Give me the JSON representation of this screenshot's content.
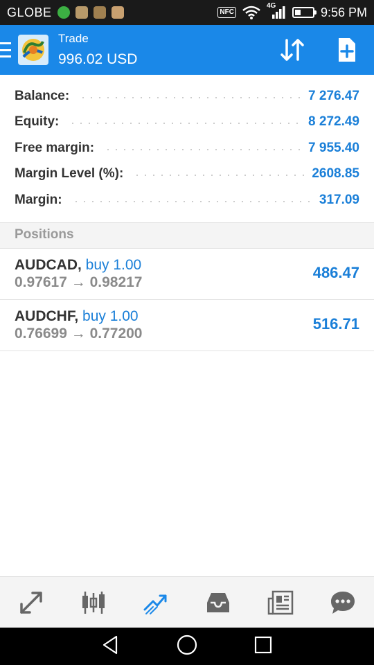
{
  "status_bar": {
    "carrier": "GLOBE",
    "network_label": "4G",
    "time": "9:56 PM",
    "icons": [
      "whatsapp-icon",
      "app-icon-a",
      "app-icon-b",
      "app-icon-c",
      "nfc-icon",
      "wifi-icon",
      "signal-icon",
      "battery-icon"
    ]
  },
  "app_bar": {
    "title": "Trade",
    "subtitle": "996.02 USD",
    "icons": [
      "menu-icon",
      "metatrader-logo",
      "sort-icon",
      "new-order-icon"
    ],
    "accent_color": "#1a88e8"
  },
  "summary": {
    "rows": [
      {
        "label": "Balance:",
        "value": "7 276.47"
      },
      {
        "label": "Equity:",
        "value": "8 272.49"
      },
      {
        "label": "Free margin:",
        "value": "7 955.40"
      },
      {
        "label": "Margin Level (%):",
        "value": "2608.85"
      },
      {
        "label": "Margin:",
        "value": "317.09"
      }
    ]
  },
  "positions": {
    "header": "Positions",
    "items": [
      {
        "symbol": "AUDCAD,",
        "side": "buy 1.00",
        "prices": "0.97617 → 0.98217",
        "profit": "486.47"
      },
      {
        "symbol": "AUDCHF,",
        "side": "buy 1.00",
        "prices": "0.76699 → 0.77200",
        "profit": "516.71"
      }
    ]
  },
  "bottom_tabs": {
    "items": [
      "quotes-icon",
      "chart-icon",
      "trade-icon",
      "history-icon",
      "news-icon",
      "chat-icon"
    ],
    "active": "trade-icon"
  },
  "nav_bar": {
    "items": [
      "back-icon",
      "home-icon",
      "recents-icon"
    ]
  }
}
